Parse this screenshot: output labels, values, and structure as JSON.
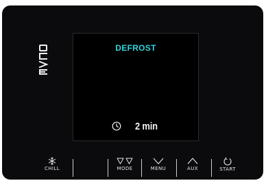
{
  "brand": {
    "logo_text": "EVCO"
  },
  "display": {
    "title": "DEFROST",
    "timer_value": "2 min"
  },
  "buttons": [
    {
      "key": "chill",
      "label": "CHILL",
      "icon": "snowflake-icon"
    },
    {
      "key": "mode",
      "label": "MODE",
      "icon": "double-down-triangle-icon"
    },
    {
      "key": "menu",
      "label": "MENU",
      "icon": "chevron-down-icon"
    },
    {
      "key": "aux",
      "label": "AUX",
      "icon": "chevron-up-icon"
    },
    {
      "key": "start",
      "label": "START",
      "icon": "refresh-icon"
    }
  ],
  "colors": {
    "panel": "#0b0b0d",
    "accent": "#2fd6dd",
    "text": "#f2f2f2"
  }
}
